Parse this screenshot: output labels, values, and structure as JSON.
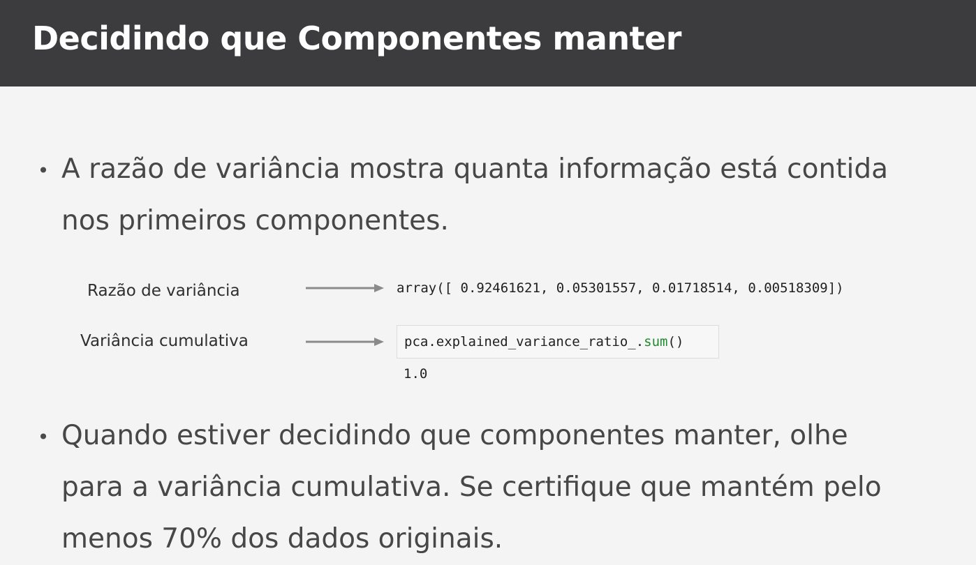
{
  "header": {
    "title": "Decidindo que Componentes manter",
    "background_color": "#3c3c3e"
  },
  "bullet_glyph": "•",
  "bullets": [
    {
      "lines": [
        "A razão de variância mostra quanta informação está contida",
        "nos primeiros componentes."
      ]
    },
    {
      "lines": [
        "Quando estiver decidindo que componentes manter, olhe",
        "para a variância cumulativa. Se certifique que mantém pelo",
        "menos 70% dos dados originais."
      ]
    }
  ],
  "rows": [
    {
      "label": "Razão de variância",
      "output": "array([ 0.92461621,  0.05301557,  0.01718514,  0.00518309])"
    },
    {
      "label": "Variância cumulativa",
      "code_object": "pca.explained_variance_ratio_.",
      "code_method": "sum",
      "code_call": "()",
      "output": "1.0"
    }
  ],
  "colors": {
    "arrow": "#8a8a8a",
    "method_green": "#1f8a2d"
  },
  "icons": {
    "arrow": "right-arrow-icon"
  }
}
